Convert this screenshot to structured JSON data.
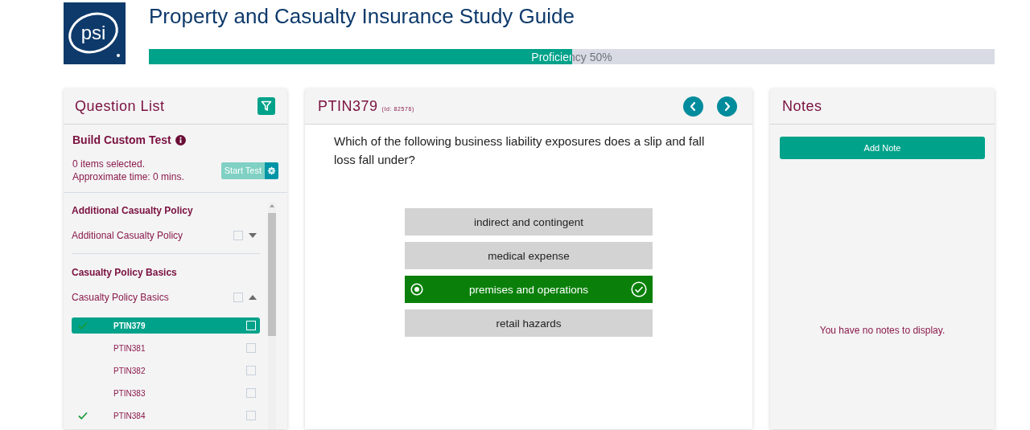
{
  "header": {
    "logo_text": "psi",
    "title": "Property and Casualty Insurance Study Guide",
    "proficiency": {
      "label": "Proficiency 50%",
      "level": 0.5
    }
  },
  "question_list": {
    "title": "Question List",
    "build_custom_test": {
      "title": "Build Custom Test",
      "selected_count": "0 items selected.",
      "approx_time": "Approximate time: 0 mins.",
      "start_button": "Start Test"
    },
    "groups": [
      {
        "heading": "Additional Casualty Policy",
        "topics": [
          {
            "label": "Additional Casualty Policy",
            "checked": false,
            "expanded": false
          }
        ]
      },
      {
        "heading": "Casualty Policy Basics",
        "topics": [
          {
            "label": "Casualty Policy Basics",
            "checked": false,
            "expanded": true,
            "children": [
              {
                "label": "PTIN379",
                "selected": true,
                "answered": true,
                "checked": false
              },
              {
                "label": "PTIN381",
                "selected": false,
                "answered": false,
                "checked": false
              },
              {
                "label": "PTIN382",
                "selected": false,
                "answered": false,
                "checked": false
              },
              {
                "label": "PTIN383",
                "selected": false,
                "answered": false,
                "checked": false
              },
              {
                "label": "PTIN384",
                "selected": false,
                "answered": true,
                "checked": false
              }
            ]
          }
        ]
      }
    ]
  },
  "question": {
    "code": "PTIN379",
    "id_label": "(Id: 82576)",
    "text": "Which of the following business liability exposures does a slip and fall loss fall under?",
    "answers": [
      {
        "text": "indirect and contingent",
        "selected": false,
        "correct": false
      },
      {
        "text": "medical expense",
        "selected": false,
        "correct": false
      },
      {
        "text": "premises and operations",
        "selected": true,
        "correct": true
      },
      {
        "text": "retail hazards",
        "selected": false,
        "correct": false
      }
    ]
  },
  "notes": {
    "title": "Notes",
    "add_button": "Add Note",
    "empty_message": "You have no notes to display."
  }
}
